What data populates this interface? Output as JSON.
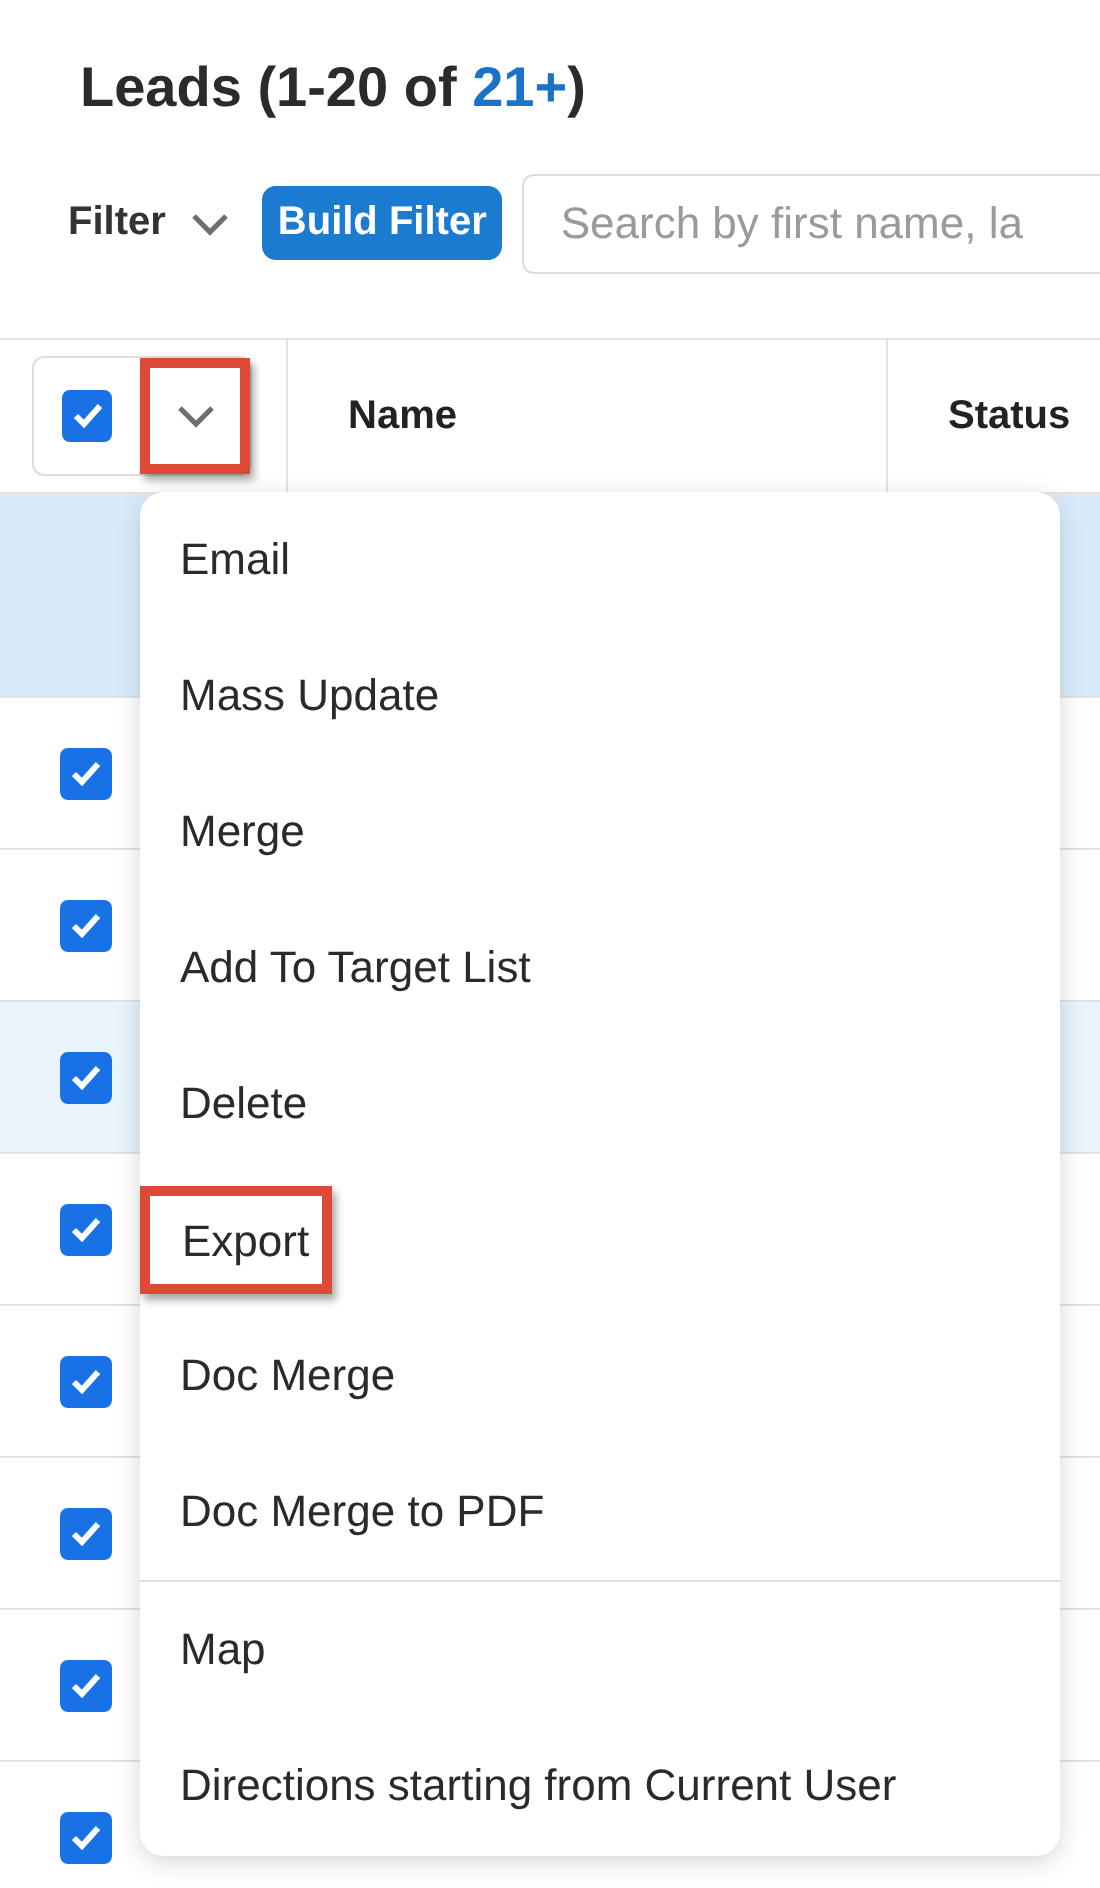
{
  "title": {
    "text": "Leads (1-20 of ",
    "count": "21+",
    "suffix": ")"
  },
  "filter": {
    "label": "Filter",
    "build_button": "Build Filter",
    "search": {
      "placeholder": "Search by first name, la"
    }
  },
  "table": {
    "select_all": {
      "checked": true
    },
    "actions_toggle": {
      "annotated": true
    },
    "columns": [
      "Name",
      "Status"
    ],
    "banner": {
      "highlighted": true
    },
    "rows": [
      {
        "checked": true,
        "highlighted": false
      },
      {
        "checked": true,
        "highlighted": false
      },
      {
        "checked": true,
        "highlighted": true
      },
      {
        "checked": true,
        "highlighted": false
      },
      {
        "checked": true,
        "highlighted": false
      },
      {
        "checked": true,
        "highlighted": false
      },
      {
        "checked": true,
        "highlighted": false
      },
      {
        "checked": true,
        "highlighted": false
      }
    ]
  },
  "menu": {
    "items": [
      {
        "label": "Email",
        "annotated": false,
        "divider_before": false
      },
      {
        "label": "Mass Update",
        "annotated": false,
        "divider_before": false
      },
      {
        "label": "Merge",
        "annotated": false,
        "divider_before": false
      },
      {
        "label": "Add To Target List",
        "annotated": false,
        "divider_before": false
      },
      {
        "label": "Delete",
        "annotated": false,
        "divider_before": false
      },
      {
        "label": "Export",
        "annotated": true,
        "divider_before": false
      },
      {
        "label": "Doc Merge",
        "annotated": false,
        "divider_before": false
      },
      {
        "label": "Doc Merge to PDF",
        "annotated": false,
        "divider_before": false
      },
      {
        "label": "Map",
        "annotated": false,
        "divider_before": true
      },
      {
        "label": "Directions starting from Current User",
        "annotated": false,
        "divider_before": false
      }
    ]
  }
}
